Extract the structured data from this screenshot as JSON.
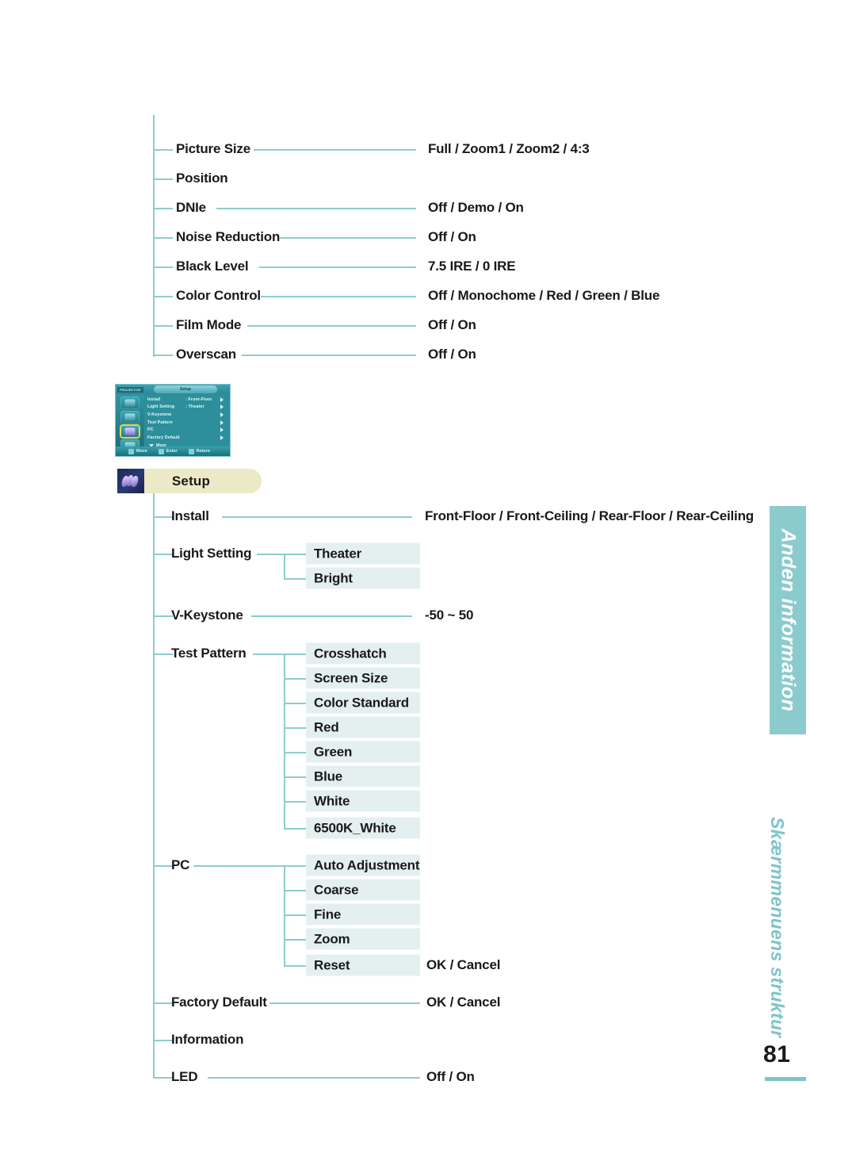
{
  "page": {
    "number": "81",
    "rail_title": "Anden information",
    "rail_subtitle": "Skærmmenuens struktur"
  },
  "colors": {
    "line": "#8ccdce",
    "chip_bg": "#e4f0ef",
    "rail_teal": "#8bcbcd",
    "rail_sub_teal": "#7ec4c8",
    "section_pill": "#ece9c6",
    "text": "#191919"
  },
  "picture_section": {
    "rows": [
      {
        "label": "Picture Size",
        "value": "Full / Zoom1 / Zoom2 / 4:3"
      },
      {
        "label": "Position",
        "value": ""
      },
      {
        "label": "DNIe",
        "value": "Off / Demo / On"
      },
      {
        "label": "Noise Reduction",
        "value": "Off / On"
      },
      {
        "label": "Black Level",
        "value": "7.5 IRE / 0 IRE"
      },
      {
        "label": "Color Control",
        "value": "Off / Monochome / Red / Green / Blue"
      },
      {
        "label": "Film Mode",
        "value": "Off / On"
      },
      {
        "label": "Overscan",
        "value": "Off / On"
      }
    ]
  },
  "osd": {
    "badge": "PROJECTOR",
    "tab": "Setup",
    "items": [
      {
        "key": "Install",
        "value": ": Front-Floor"
      },
      {
        "key": "Light Setting",
        "value": ": Theater"
      },
      {
        "key": "V-Keystone",
        "value": ""
      },
      {
        "key": "Test Pattern",
        "value": ""
      },
      {
        "key": "PC",
        "value": ""
      },
      {
        "key": "Factory Default",
        "value": ""
      }
    ],
    "more": "More",
    "footer": [
      {
        "label": "Move"
      },
      {
        "label": "Enter"
      },
      {
        "label": "Return"
      }
    ]
  },
  "setup_section": {
    "title": "Setup",
    "rows": [
      {
        "label": "Install",
        "value": "Front-Floor / Front-Ceiling / Rear-Floor / Rear-Ceiling"
      },
      {
        "label": "Light Setting",
        "value": ""
      },
      {
        "label": "V-Keystone",
        "value": "-50 ~ 50"
      },
      {
        "label": "Test Pattern",
        "value": ""
      },
      {
        "label": "PC",
        "value": ""
      },
      {
        "label": "Factory Default",
        "value": "OK / Cancel"
      },
      {
        "label": "Information",
        "value": ""
      },
      {
        "label": "LED",
        "value": "Off / On"
      }
    ],
    "light_setting_children": [
      {
        "label": "Theater",
        "value": ""
      },
      {
        "label": "Bright",
        "value": ""
      }
    ],
    "test_pattern_children": [
      {
        "label": "Crosshatch",
        "value": ""
      },
      {
        "label": "Screen Size",
        "value": ""
      },
      {
        "label": "Color Standard",
        "value": ""
      },
      {
        "label": "Red",
        "value": ""
      },
      {
        "label": "Green",
        "value": ""
      },
      {
        "label": "Blue",
        "value": ""
      },
      {
        "label": "White",
        "value": ""
      },
      {
        "label": "6500K_White",
        "value": ""
      }
    ],
    "pc_children": [
      {
        "label": "Auto Adjustment",
        "value": ""
      },
      {
        "label": "Coarse",
        "value": ""
      },
      {
        "label": "Fine",
        "value": ""
      },
      {
        "label": "Zoom",
        "value": ""
      },
      {
        "label": "Reset",
        "value": "OK / Cancel"
      }
    ]
  }
}
